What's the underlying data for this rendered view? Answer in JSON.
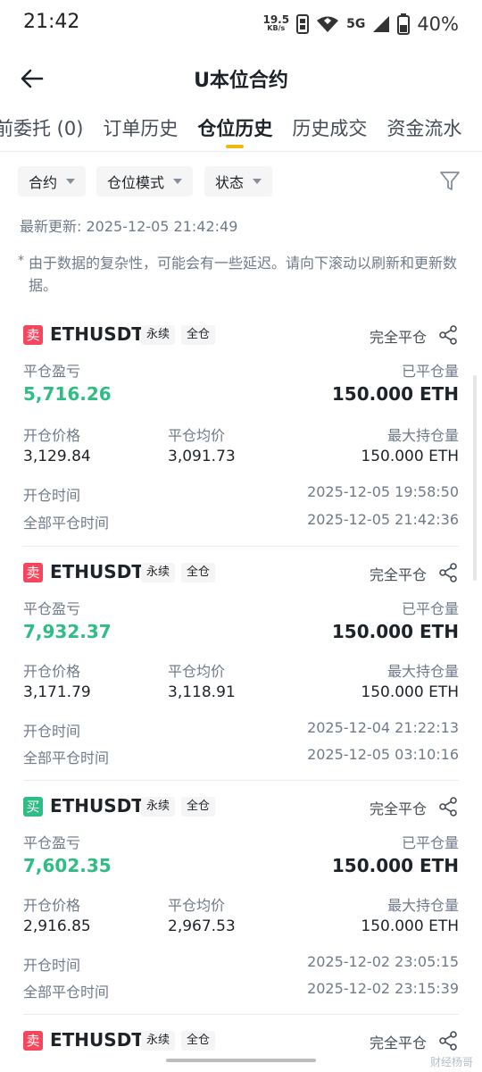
{
  "status_bar": {
    "time": "21:42",
    "net_speed": "19.5",
    "net_unit": "KB/s",
    "network": "5G",
    "battery": "40%"
  },
  "header": {
    "title": "U本位合约"
  },
  "tabs": [
    {
      "label": "前委托 (0)"
    },
    {
      "label": "订单历史"
    },
    {
      "label": "仓位历史",
      "active": true
    },
    {
      "label": "历史成交"
    },
    {
      "label": "资金流水"
    }
  ],
  "filters": {
    "contract": "合约",
    "position_mode": "仓位模式",
    "status": "状态"
  },
  "updated": "最新更新: 2025-12-05 21:42:49",
  "note": {
    "star": "*",
    "text": "由于数据的复杂性，可能会有一些延迟。请向下滚动以刷新和更新数据。"
  },
  "labels": {
    "pnl": "平仓盈亏",
    "closed_qty": "已平仓量",
    "open_price": "开仓价格",
    "close_avg": "平仓均价",
    "max_hold": "最大持仓量",
    "open_time": "开仓时间",
    "full_close_time": "全部平仓时间"
  },
  "positions": [
    {
      "side": "卖",
      "side_type": "sell",
      "symbol": "ETHUSDT",
      "tag1": "永续",
      "tag2": "全仓",
      "close_type": "完全平仓",
      "pnl": "5,716.26",
      "closed_qty": "150.000 ETH",
      "open_price": "3,129.84",
      "close_avg": "3,091.73",
      "max_hold": "150.000 ETH",
      "open_time": "2025-12-05 19:58:50",
      "full_close_time": "2025-12-05 21:42:36"
    },
    {
      "side": "卖",
      "side_type": "sell",
      "symbol": "ETHUSDT",
      "tag1": "永续",
      "tag2": "全仓",
      "close_type": "完全平仓",
      "pnl": "7,932.37",
      "closed_qty": "150.000 ETH",
      "open_price": "3,171.79",
      "close_avg": "3,118.91",
      "max_hold": "150.000 ETH",
      "open_time": "2025-12-04 21:22:13",
      "full_close_time": "2025-12-05 03:10:16"
    },
    {
      "side": "买",
      "side_type": "buy",
      "symbol": "ETHUSDT",
      "tag1": "永续",
      "tag2": "全仓",
      "close_type": "完全平仓",
      "pnl": "7,602.35",
      "closed_qty": "150.000 ETH",
      "open_price": "2,916.85",
      "close_avg": "2,967.53",
      "max_hold": "150.000 ETH",
      "open_time": "2025-12-02 23:05:15",
      "full_close_time": "2025-12-02 23:15:39"
    },
    {
      "side": "卖",
      "side_type": "sell",
      "symbol": "ETHUSDT",
      "tag1": "永续",
      "tag2": "全仓",
      "close_type": "完全平仓"
    }
  ],
  "watermark": "财经杨哥",
  "colors": {
    "accent": "#f0b90b",
    "profit": "#2ebd85",
    "sell": "#f6465d",
    "buy": "#2ebd85"
  }
}
